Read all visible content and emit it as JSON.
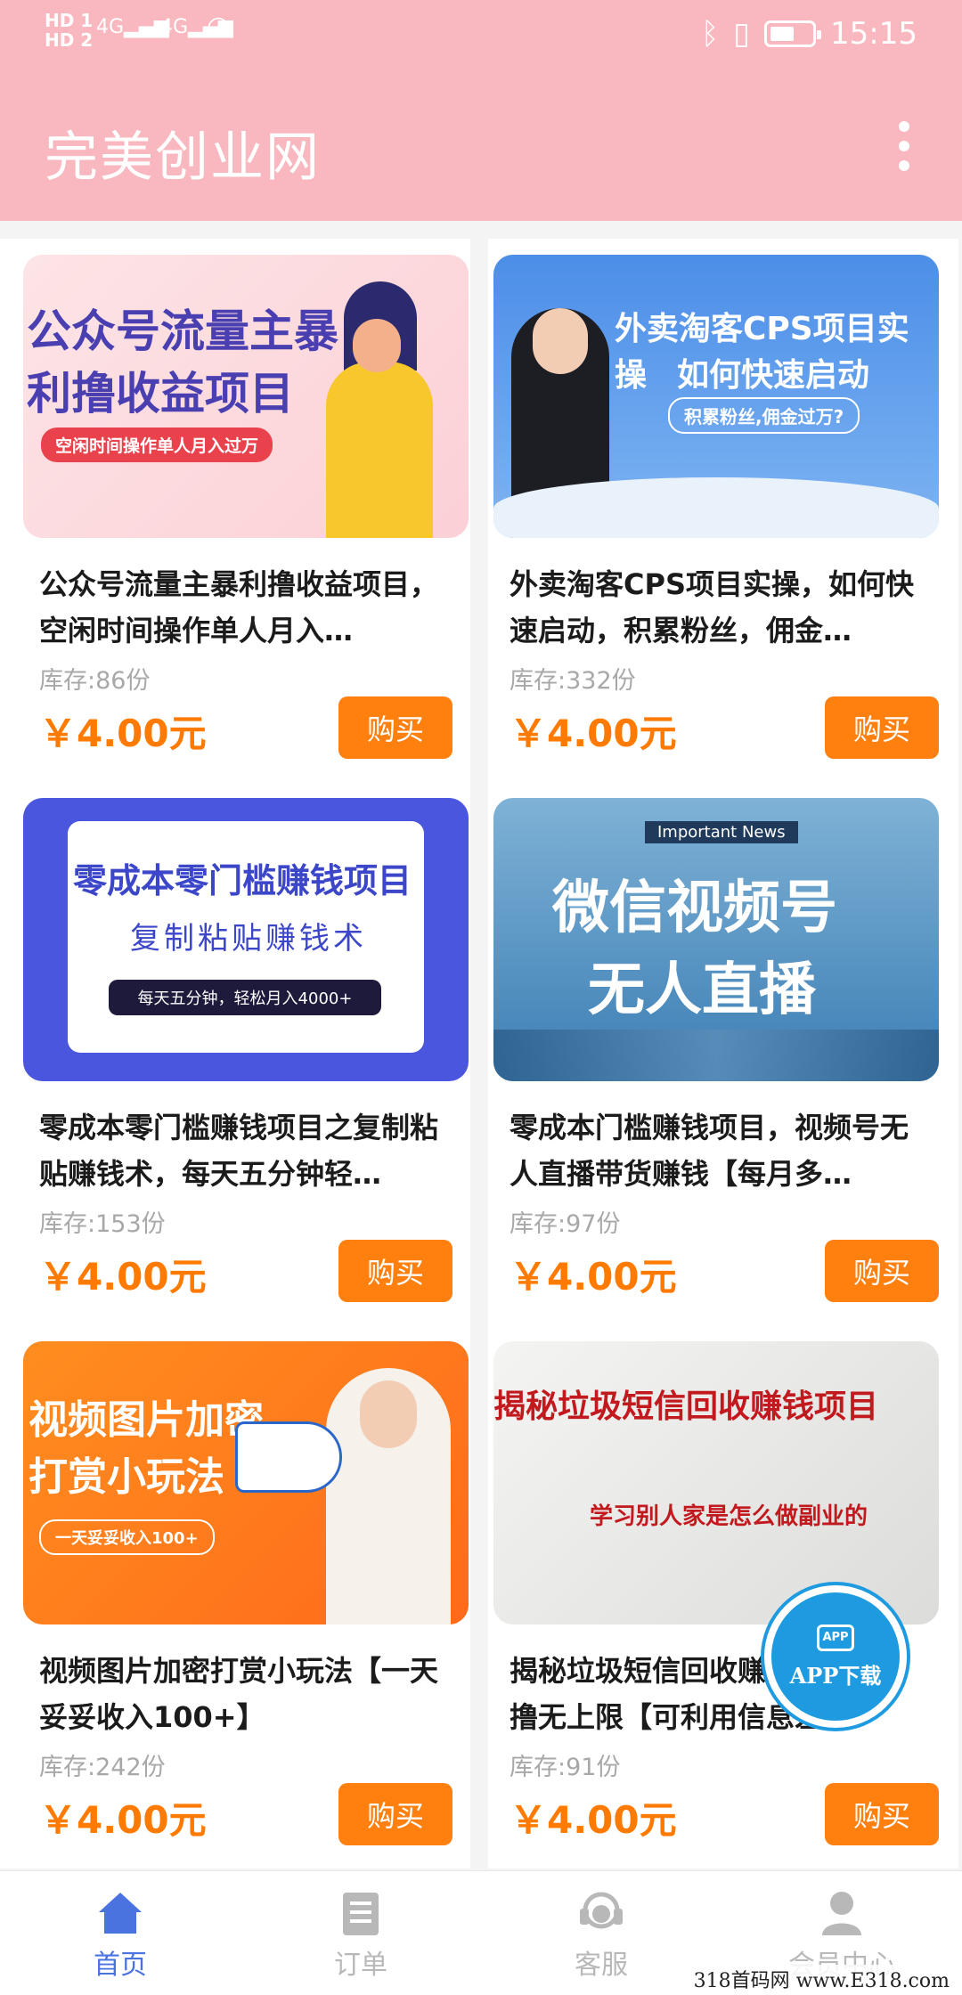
{
  "status_bar": {
    "hd1": "HD 1",
    "hd2": "HD 2",
    "net1": "4G",
    "net2": "4G",
    "time": "15:15"
  },
  "header": {
    "title": "完美创业网"
  },
  "products": [
    {
      "banner_line1": "公众号流量主暴",
      "banner_line2": "利撸收益项目",
      "banner_tag": "空闲时间操作单人月入过万",
      "title": "公众号流量主暴利撸收益项目，空闲时间操作单人月入…",
      "stock": "库存:86份",
      "price": "￥4.00元",
      "buy_label": "购买"
    },
    {
      "banner_line1": "外卖淘客CPS项目实操",
      "banner_line2": "如何快速启动",
      "banner_tag": "积累粉丝,佣金过万?",
      "title": "外卖淘客CPS项目实操，如何快速启动，积累粉丝，佣金…",
      "stock": "库存:332份",
      "price": "￥4.00元",
      "buy_label": "购买"
    },
    {
      "banner_line1": "零成本零门槛赚钱项目",
      "banner_line2": "复制粘贴赚钱术",
      "banner_tag": "每天五分钟，轻松月入4000+",
      "title": "零成本零门槛赚钱项目之复制粘贴赚钱术，每天五分钟轻…",
      "stock": "库存:153份",
      "price": "￥4.00元",
      "buy_label": "购买"
    },
    {
      "banner_top": "Important News",
      "banner_line1": "微信视频号",
      "banner_line2": "无人直播",
      "title": "零成本门槛赚钱项目，视频号无人直播带货赚钱【每月多…",
      "stock": "库存:97份",
      "price": "￥4.00元",
      "buy_label": "购买"
    },
    {
      "banner_line1": "视频图片加密",
      "banner_line2": "打赏小玩法",
      "banner_tag": "一天妥妥收入100+",
      "title": "视频图片加密打赏小玩法【一天妥妥收入100+】",
      "stock": "库存:242份",
      "price": "￥4.00元",
      "buy_label": "购买"
    },
    {
      "banner_line1": "揭秘垃圾短信回收赚钱项目",
      "banner_tag": "学习别人家是怎么做副业的",
      "title": "揭秘垃圾短信回收赚钱项目，日撸无上限【可利用信息差…",
      "stock": "库存:91份",
      "price": "￥4.00元",
      "buy_label": "购买"
    }
  ],
  "app_badge": {
    "icon_text": "APP",
    "label": "APP下载"
  },
  "bottom_nav": [
    {
      "label": "首页",
      "icon": "home-icon"
    },
    {
      "label": "订单",
      "icon": "clipboard-icon"
    },
    {
      "label": "客服",
      "icon": "headset-icon"
    },
    {
      "label": "会员中心",
      "icon": "user-icon"
    }
  ],
  "watermark": "318首码网 www.E318.com",
  "colors": {
    "header_bg": "#f9b8bf",
    "price": "#ff7a00",
    "buy_button": "#ff7f0f",
    "nav_active": "#4a73df",
    "app_badge": "#1e9be0"
  }
}
